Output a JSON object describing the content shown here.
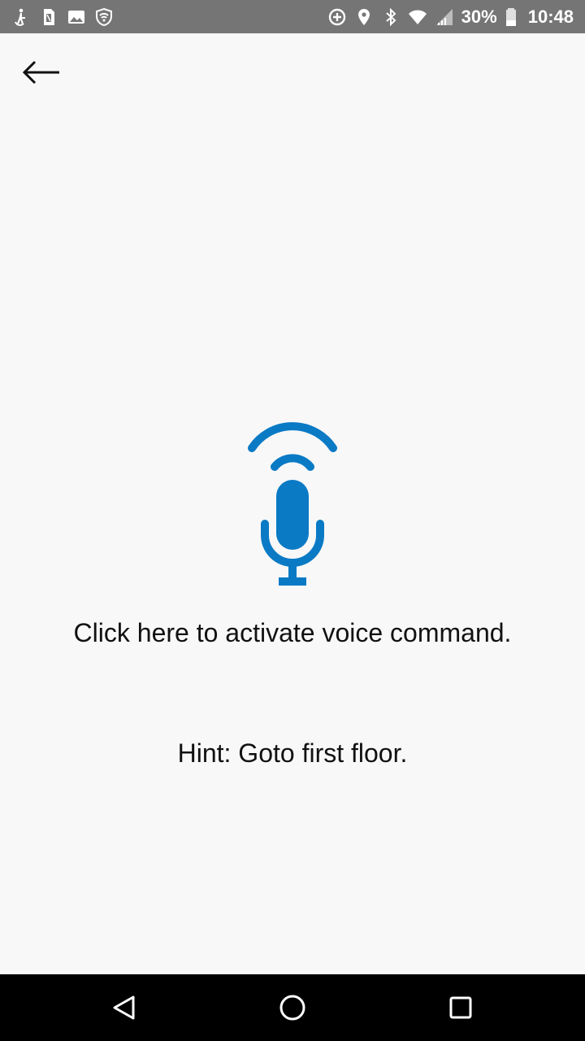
{
  "status_bar": {
    "battery_percent": "30%",
    "time": "10:48",
    "left_icons": [
      "accessibility-icon",
      "sim-card-icon",
      "image-icon",
      "shield-wifi-icon"
    ],
    "right_icons": [
      "data-saver-icon",
      "location-icon",
      "bluetooth-icon",
      "wifi-icon",
      "cell-signal-icon",
      "battery-icon"
    ]
  },
  "toolbar": {
    "back_icon": "arrow-left-icon"
  },
  "main": {
    "mic_icon": "voice-microphone-icon",
    "mic_color": "#0a7ac5",
    "activate_label": "Click here to activate voice command.",
    "hint_label": "Hint: Goto first floor."
  },
  "nav_bar": {
    "back_icon": "nav-back-icon",
    "home_icon": "nav-home-icon",
    "recents_icon": "nav-recents-icon"
  }
}
